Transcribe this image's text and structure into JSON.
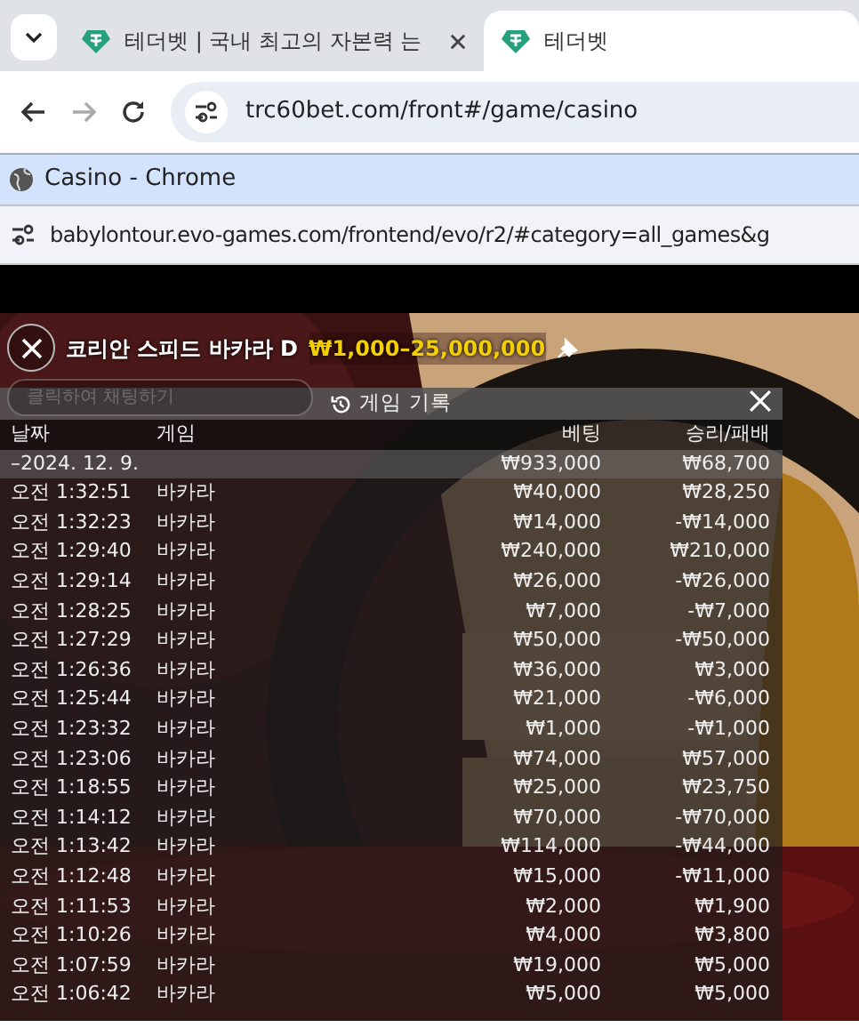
{
  "browser": {
    "tabs": [
      {
        "title": "테더벳 | 국내 최고의 자본력 는",
        "selected": false
      },
      {
        "title": "테더벳",
        "selected": true
      }
    ],
    "url": "trc60bet.com/front#/game/casino"
  },
  "popup": {
    "title": "Casino - Chrome",
    "url": "babylontour.evo-games.com/frontend/evo/r2/#category=all_games&g"
  },
  "game": {
    "table_name": "코리안 스피드 바카라 D",
    "limits": "₩1,000–25,000,000",
    "chat": {
      "placeholder": "클릭하여 채팅하기"
    }
  },
  "history": {
    "title": "게임 기록",
    "columns": [
      "날짜",
      "게임",
      "베팅",
      "승리/패배"
    ],
    "summary": {
      "date": "–2024. 12. 9.",
      "bet": "₩933,000",
      "result": "₩68,700"
    },
    "rows": [
      {
        "time": "오전 1:32:51",
        "game": "바카라",
        "bet": "₩40,000",
        "result": "₩28,250"
      },
      {
        "time": "오전 1:32:23",
        "game": "바카라",
        "bet": "₩14,000",
        "result": "-₩14,000"
      },
      {
        "time": "오전 1:29:40",
        "game": "바카라",
        "bet": "₩240,000",
        "result": "₩210,000"
      },
      {
        "time": "오전 1:29:14",
        "game": "바카라",
        "bet": "₩26,000",
        "result": "-₩26,000"
      },
      {
        "time": "오전 1:28:25",
        "game": "바카라",
        "bet": "₩7,000",
        "result": "-₩7,000"
      },
      {
        "time": "오전 1:27:29",
        "game": "바카라",
        "bet": "₩50,000",
        "result": "-₩50,000"
      },
      {
        "time": "오전 1:26:36",
        "game": "바카라",
        "bet": "₩36,000",
        "result": "₩3,000"
      },
      {
        "time": "오전 1:25:44",
        "game": "바카라",
        "bet": "₩21,000",
        "result": "-₩6,000"
      },
      {
        "time": "오전 1:23:32",
        "game": "바카라",
        "bet": "₩1,000",
        "result": "-₩1,000"
      },
      {
        "time": "오전 1:23:06",
        "game": "바카라",
        "bet": "₩74,000",
        "result": "₩57,000"
      },
      {
        "time": "오전 1:18:55",
        "game": "바카라",
        "bet": "₩25,000",
        "result": "₩23,750"
      },
      {
        "time": "오전 1:14:12",
        "game": "바카라",
        "bet": "₩70,000",
        "result": "-₩70,000"
      },
      {
        "time": "오전 1:13:42",
        "game": "바카라",
        "bet": "₩114,000",
        "result": "-₩44,000"
      },
      {
        "time": "오전 1:12:48",
        "game": "바카라",
        "bet": "₩15,000",
        "result": "-₩11,000"
      },
      {
        "time": "오전 1:11:53",
        "game": "바카라",
        "bet": "₩2,000",
        "result": "₩1,900"
      },
      {
        "time": "오전 1:10:26",
        "game": "바카라",
        "bet": "₩4,000",
        "result": "₩3,800"
      },
      {
        "time": "오전 1:07:59",
        "game": "바카라",
        "bet": "₩19,000",
        "result": "₩5,000"
      },
      {
        "time": "오전 1:06:42",
        "game": "바카라",
        "bet": "₩5,000",
        "result": "₩5,000"
      }
    ]
  }
}
